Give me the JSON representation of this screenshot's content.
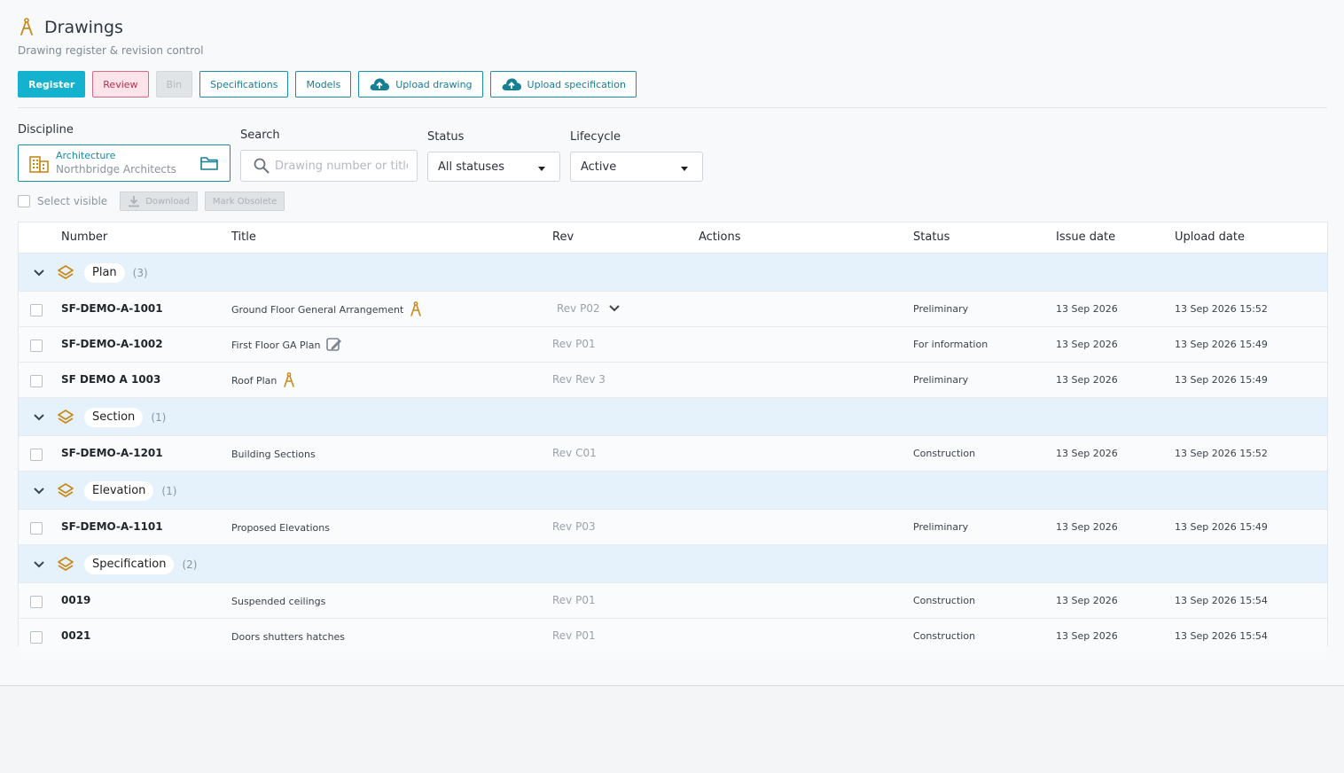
{
  "header": {
    "title": "Drawings",
    "subtitle": "Drawing register & revision control"
  },
  "toolbar": {
    "register": "Register",
    "review": "Review",
    "bin": "Bin",
    "specifications": "Specifications",
    "models": "Models",
    "upload_drawing": "Upload drawing",
    "upload_specification": "Upload specification"
  },
  "filters": {
    "discipline_label": "Discipline",
    "discipline_name": "Architecture",
    "discipline_company": "Northbridge Architects",
    "search_label": "Search",
    "search_placeholder": "Drawing number or title",
    "search_value": "",
    "status_label": "Status",
    "status_value": "All statuses",
    "lifecycle_label": "Lifecycle",
    "lifecycle_value": "Active"
  },
  "bulk": {
    "select_visible": "Select visible",
    "download": "Download",
    "mark_obsolete": "Mark Obsolete"
  },
  "table": {
    "headers": {
      "number": "Number",
      "title": "Title",
      "rev": "Rev",
      "actions": "Actions",
      "status": "Status",
      "issue_date": "Issue date",
      "upload_date": "Upload date"
    },
    "groups": [
      {
        "name": "Plan",
        "count": "(3)",
        "rows": [
          {
            "number": "SF-DEMO-A-1001",
            "title": "Ground Floor General Arrangement",
            "icon": "compass-icon",
            "rev": "Rev P02",
            "has_rev_menu": true,
            "status": "Preliminary",
            "issue_date": "13 Sep 2026",
            "upload_date": "13 Sep 2026 15:52"
          },
          {
            "number": "SF-DEMO-A-1002",
            "title": "First Floor GA Plan",
            "icon": "edit-pencil-icon",
            "rev": "Rev P01",
            "status": "For information",
            "issue_date": "13 Sep 2026",
            "upload_date": "13 Sep 2026 15:49"
          },
          {
            "number": "SF DEMO A 1003",
            "title": "Roof Plan",
            "icon": "compass-icon",
            "rev": "Rev Rev 3",
            "status": "Preliminary",
            "issue_date": "13 Sep 2026",
            "upload_date": "13 Sep 2026 15:49"
          }
        ]
      },
      {
        "name": "Section",
        "count": "(1)",
        "rows": [
          {
            "number": "SF-DEMO-A-1201",
            "title": "Building Sections",
            "rev": "Rev C01",
            "status": "Construction",
            "issue_date": "13 Sep 2026",
            "upload_date": "13 Sep 2026 15:52"
          }
        ]
      },
      {
        "name": "Elevation",
        "count": "(1)",
        "rows": [
          {
            "number": "SF-DEMO-A-1101",
            "title": "Proposed Elevations",
            "rev": "Rev P03",
            "status": "Preliminary",
            "issue_date": "13 Sep 2026",
            "upload_date": "13 Sep 2026 15:49"
          }
        ]
      },
      {
        "name": "Specification",
        "count": "(2)",
        "rows": [
          {
            "number": "0019",
            "title": "Suspended ceilings",
            "rev": "Rev P01",
            "status": "Construction",
            "issue_date": "13 Sep 2026",
            "upload_date": "13 Sep 2026 15:54"
          },
          {
            "number": "0021",
            "title": "Doors shutters hatches",
            "rev": "Rev P01",
            "status": "Construction",
            "issue_date": "13 Sep 2026",
            "upload_date": "13 Sep 2026 15:54"
          }
        ]
      }
    ]
  },
  "colors": {
    "accent": "#15b2cf",
    "accent_dark": "#1a8fa3",
    "review": "#d86a86",
    "icon_gold": "#c8891a",
    "group_bg": "#e5f2fb"
  }
}
